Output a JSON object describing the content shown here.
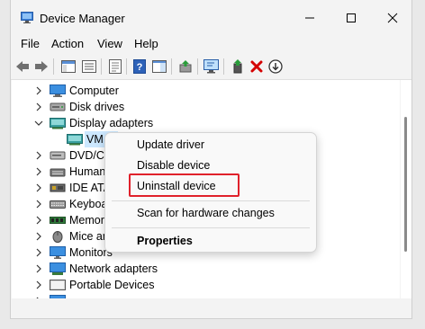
{
  "window": {
    "title": "Device Manager"
  },
  "menu": [
    "File",
    "Action",
    "View",
    "Help"
  ],
  "tree": {
    "rows": [
      {
        "label": "Computer",
        "icon": "computer-icon",
        "expanded": false
      },
      {
        "label": "Disk drives",
        "icon": "disk-drive-icon",
        "expanded": false
      },
      {
        "label": "Display adapters",
        "icon": "display-adapter-icon",
        "expanded": true
      },
      {
        "label": "VM",
        "icon": "display-adapter-icon",
        "child": true,
        "selected": true
      },
      {
        "label": "DVD/CI",
        "icon": "dvd-drive-icon",
        "expanded": false
      },
      {
        "label": "Human",
        "icon": "hid-icon",
        "expanded": false
      },
      {
        "label": "IDE ATA",
        "icon": "ide-controller-icon",
        "expanded": false
      },
      {
        "label": "Keyboa",
        "icon": "keyboard-icon",
        "expanded": false
      },
      {
        "label": "Memor",
        "icon": "memory-icon",
        "expanded": false
      },
      {
        "label": "Mice an",
        "icon": "mouse-icon",
        "expanded": false
      },
      {
        "label": "Monitors",
        "icon": "monitor-icon",
        "expanded": false
      },
      {
        "label": "Network adapters",
        "icon": "network-adapter-icon",
        "expanded": false
      },
      {
        "label": "Portable Devices",
        "icon": "portable-device-icon",
        "expanded": false
      }
    ]
  },
  "context_menu": {
    "items": [
      {
        "label": "Update driver"
      },
      {
        "label": "Disable device"
      },
      {
        "label": "Uninstall device",
        "highlighted": true
      },
      {
        "label": "Scan for hardware changes"
      },
      {
        "label": "Properties",
        "bold": true
      }
    ]
  },
  "colors": {
    "highlight": "#e0212b",
    "selection": "#cce8ff",
    "remove_x": "#d40000"
  }
}
